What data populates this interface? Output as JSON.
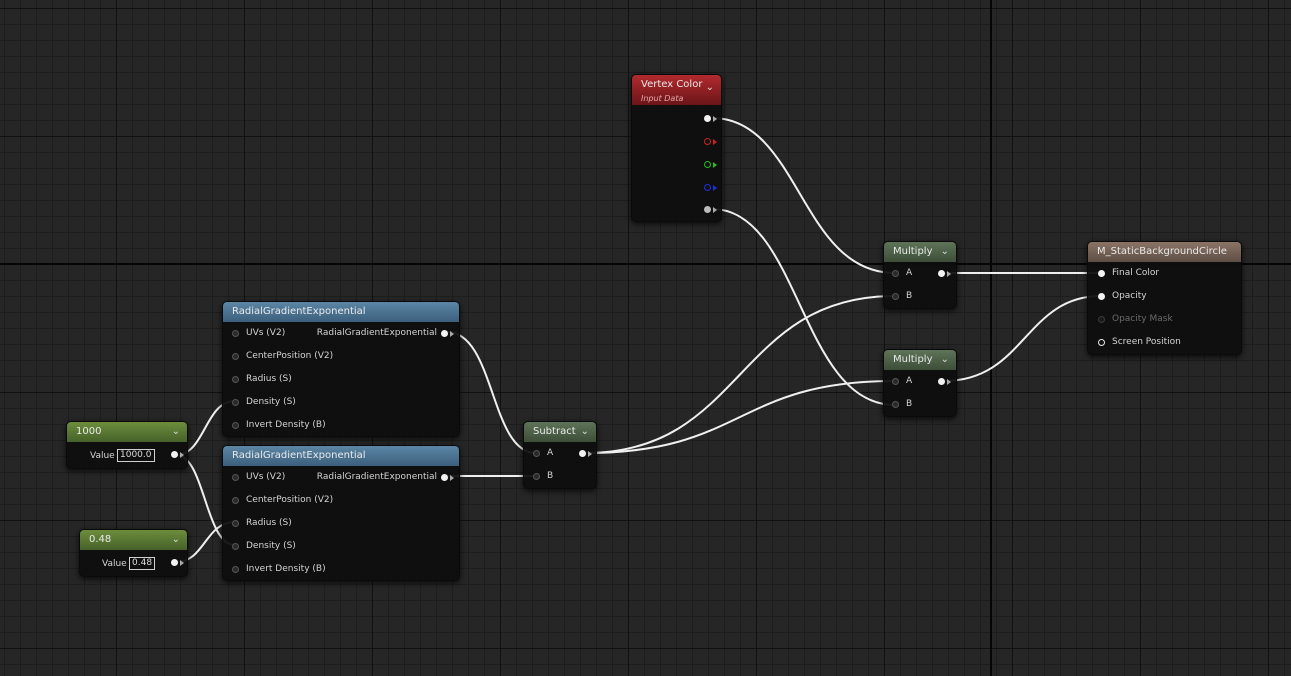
{
  "nodes": {
    "vertex_color": {
      "title": "Vertex Color",
      "subtitle": "Input Data"
    },
    "multiply_top": {
      "title": "Multiply",
      "pins": [
        "A",
        "B"
      ]
    },
    "multiply_bottom": {
      "title": "Multiply",
      "pins": [
        "A",
        "B"
      ]
    },
    "material": {
      "title": "M_StaticBackgroundCircle",
      "pins": [
        "Final Color",
        "Opacity",
        "Opacity Mask",
        "Screen Position"
      ]
    },
    "radial_top": {
      "title": "RadialGradientExponential",
      "inputs": [
        "UVs (V2)",
        "CenterPosition (V2)",
        "Radius (S)",
        "Density (S)",
        "Invert Density (B)"
      ],
      "output": "RadialGradientExponential"
    },
    "radial_bottom": {
      "title": "RadialGradientExponential",
      "inputs": [
        "UVs (V2)",
        "CenterPosition (V2)",
        "Radius (S)",
        "Density (S)",
        "Invert Density (B)"
      ],
      "output": "RadialGradientExponential"
    },
    "subtract": {
      "title": "Subtract",
      "pins": [
        "A",
        "B"
      ]
    },
    "const_1000": {
      "title": "1000",
      "value_label": "Value",
      "value": "1000.0"
    },
    "const_048": {
      "title": "0.48",
      "value_label": "Value",
      "value": "0.48"
    }
  },
  "colors": {
    "wire": "#f0f0f0",
    "vertex_r": "#d02020",
    "vertex_g": "#20c020",
    "vertex_b": "#2030e0"
  }
}
